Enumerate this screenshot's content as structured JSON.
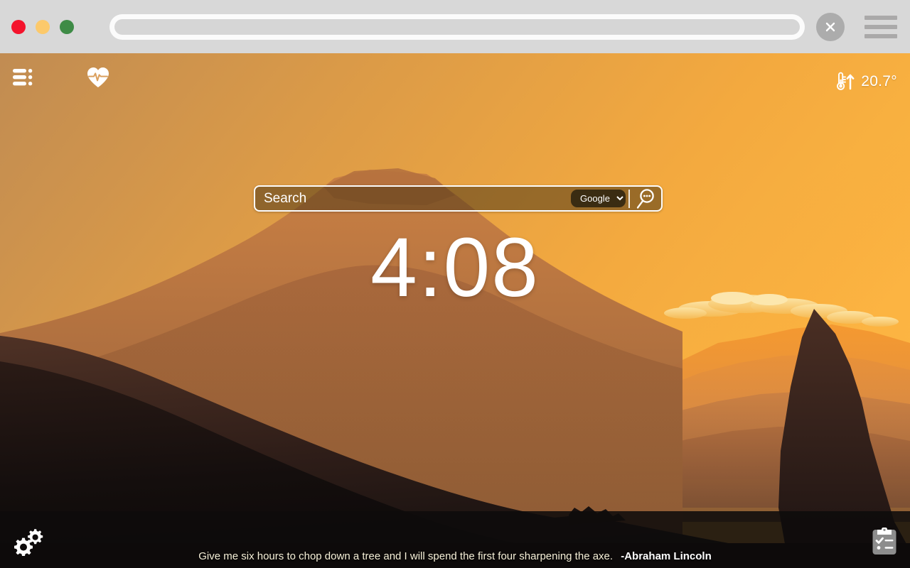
{
  "browser": {
    "traffic_lights": [
      {
        "name": "close",
        "color": "#f4132c"
      },
      {
        "name": "minimize",
        "color": "#fcc96b"
      },
      {
        "name": "zoom",
        "color": "#3e8b46"
      }
    ],
    "url_value": "",
    "url_placeholder": "",
    "close_tab_label": "X",
    "menu_icon": "hamburger-menu-icon"
  },
  "topbar": {
    "bookmarks_icon": "bookmark-list-icon",
    "fitness_icon": "heart-pulse-icon",
    "weather": {
      "icon": "thermometer-rising-icon",
      "temperature": "20.7°"
    }
  },
  "search": {
    "placeholder": "Search",
    "value": "",
    "engine_selected": "Google",
    "engine_options": [
      "Google"
    ],
    "submit_icon": "magnifier-chat-icon"
  },
  "clock": {
    "time": "4:08"
  },
  "bottom": {
    "settings_icon": "gears-settings-icon",
    "todo_icon": "clipboard-checklist-icon",
    "quote": "Give me six hours to chop down a tree and I will spend the first four sharpening the axe.",
    "quote_author": "-Abraham Lincoln"
  },
  "colors": {
    "chrome_bg": "#d8d8d8",
    "sky_top_left": "#c79355",
    "sky_top_right": "#f6aa3e",
    "sky_glow": "#fbb540",
    "mountain_far": "#f59a34",
    "mountain_mid": "#c4783f",
    "mountain_near": "#6d4630",
    "mountain_front": "#2a1a16",
    "foreground": "#0e0b0b",
    "cloud": "#fbd27a",
    "search_bg": "rgba(72,52,20,0.52)",
    "quote_text": "#f6f0d8"
  }
}
